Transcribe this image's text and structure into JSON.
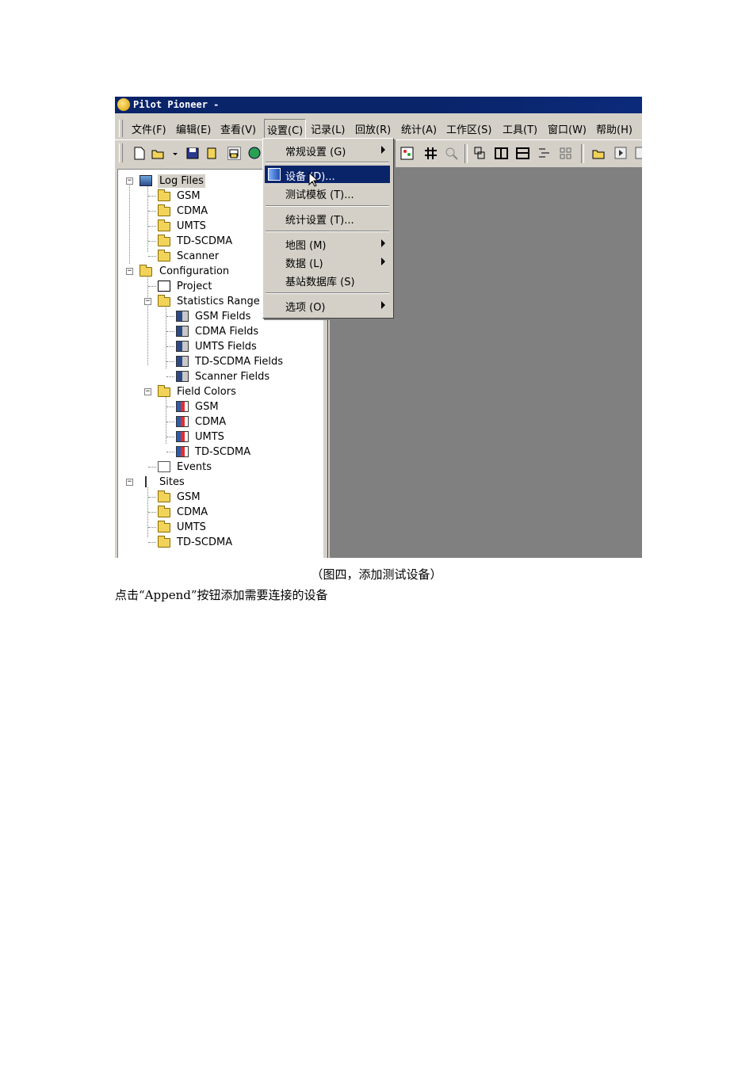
{
  "window": {
    "title": "Pilot Pioneer -"
  },
  "menubar": {
    "items": [
      "文件(F)",
      "编辑(E)",
      "查看(V)",
      "设置(C)",
      "记录(L)",
      "回放(R)",
      "统计(A)",
      "工作区(S)",
      "工具(T)",
      "窗口(W)",
      "帮助(H)"
    ],
    "open_item": "设置(C)"
  },
  "toolbar": {
    "icons": [
      "new-file-icon",
      "open-folder-icon",
      "dropdown-arrow-icon",
      "save-icon",
      "book-icon",
      "print-preview-icon",
      "globe-icon",
      "chart-icon",
      "grid-icon",
      "magnifier-icon",
      "layout-icon",
      "columns-icon",
      "rows-icon",
      "tree-layout-icon",
      "tiles-icon",
      "open-icon",
      "play-icon",
      "stop-icon"
    ]
  },
  "settings_menu": {
    "items": [
      {
        "label": "常规设置 (G)",
        "submenu": true
      },
      {
        "label": "设备 (D)...",
        "highlighted": true
      },
      {
        "label": "测试模板 (T)..."
      },
      {
        "label": "统计设置 (T)..."
      },
      {
        "label": "地图 (M)",
        "submenu": true
      },
      {
        "label": "数据 (L)",
        "submenu": true
      },
      {
        "label": "基站数据库 (S)"
      },
      {
        "label": "选项 (O)",
        "submenu": true
      }
    ]
  },
  "tree": {
    "log_files": "Log Files",
    "log_children": [
      "GSM",
      "CDMA",
      "UMTS",
      "TD-SCDMA",
      "Scanner"
    ],
    "configuration": "Configuration",
    "project": "Project",
    "statistics_range": "Statistics Range",
    "stat_children": [
      "GSM Fields",
      "CDMA Fields",
      "UMTS Fields",
      "TD-SCDMA Fields",
      "Scanner Fields"
    ],
    "field_colors": "Field Colors",
    "color_children": [
      "GSM",
      "CDMA",
      "UMTS",
      "TD-SCDMA"
    ],
    "events": "Events",
    "sites": "Sites",
    "site_children": [
      "GSM",
      "CDMA",
      "UMTS",
      "TD-SCDMA"
    ]
  },
  "document": {
    "caption": "（图四，添加测试设备）",
    "body": "点击“Append”按钮添加需要连接的设备"
  },
  "colors": {
    "titlebar": "#0a246a",
    "menu_highlight": "#0a246a",
    "workspace": "#808080",
    "face": "#d4d0c8"
  }
}
